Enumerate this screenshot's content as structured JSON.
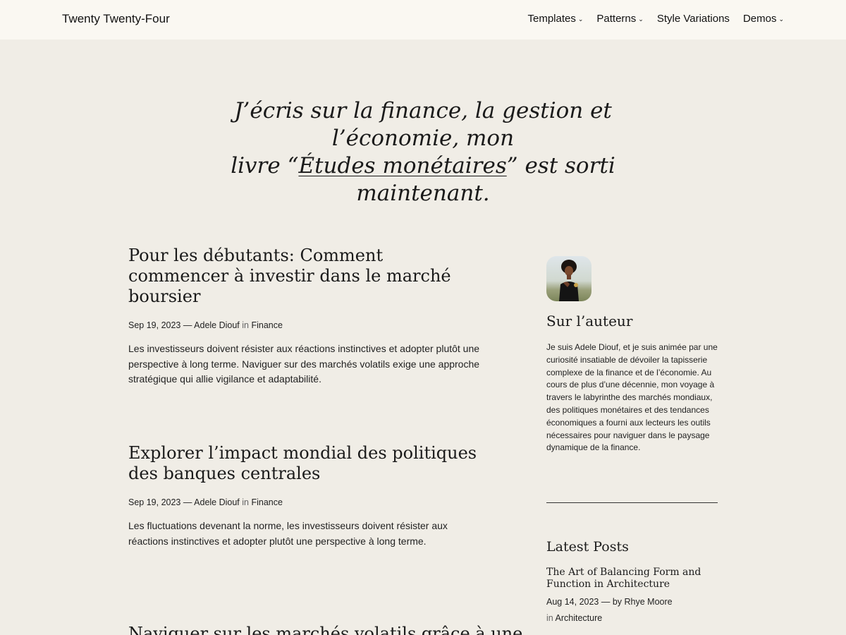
{
  "header": {
    "site_title": "Twenty Twenty-Four",
    "nav": [
      {
        "label": "Templates",
        "has_dropdown": true
      },
      {
        "label": "Patterns",
        "has_dropdown": true
      },
      {
        "label": "Style Variations",
        "has_dropdown": false
      },
      {
        "label": "Demos",
        "has_dropdown": true
      }
    ]
  },
  "hero": {
    "line1": "J’écris sur la finance, la gestion et l’économie, mon",
    "line2_prefix": "livre “",
    "book_link": "Études monétaires",
    "line2_suffix": "” est sorti maintenant."
  },
  "posts": [
    {
      "title": "Pour les débutants: Comment commencer à investir dans le marché boursier",
      "date": "Sep 19, 2023",
      "separator": "—",
      "author": "Adele Diouf",
      "in": "in",
      "category": "Finance",
      "excerpt": "Les investisseurs doivent résister aux réactions instinctives et adopter plutôt une perspective à long terme. Naviguer sur des marchés volatils exige une approche stratégique qui allie vigilance et adaptabilité."
    },
    {
      "title": "Explorer l’impact mondial des politiques des banques centrales",
      "date": "Sep 19, 2023",
      "separator": "—",
      "author": "Adele Diouf",
      "in": "in",
      "category": "Finance",
      "excerpt": "Les fluctuations devenant la norme, les investisseurs doivent résister aux réactions instinctives et adopter plutôt une perspective à long terme."
    },
    {
      "title": "Naviguer sur les marchés volatils grâce à une"
    }
  ],
  "sidebar": {
    "author_heading": "Sur l’auteur",
    "author_bio": "Je suis Adele Diouf, et je suis animée par une curiosité insatiable de dévoiler la tapisserie complexe de la finance et de l’économie. Au cours de plus d’une décennie, mon voyage à travers le labyrinthe des marchés mondiaux, des politiques monétaires et des tendances économiques a fourni aux lecteurs les outils nécessaires pour naviguer dans le paysage dynamique de la finance.",
    "latest_heading": "Latest Posts",
    "latest": {
      "title": "The Art of Balancing Form and Function in Architecture",
      "date": "Aug 14, 2023",
      "by_prefix": "— by",
      "author": "Rhye Moore",
      "in": "in",
      "category": "Architecture"
    }
  },
  "icons": {
    "dropdown": "chevron-down-icon"
  },
  "colors": {
    "background": "#f0ede6",
    "header_bg": "#faf8f2",
    "text": "#1c1c1c"
  }
}
